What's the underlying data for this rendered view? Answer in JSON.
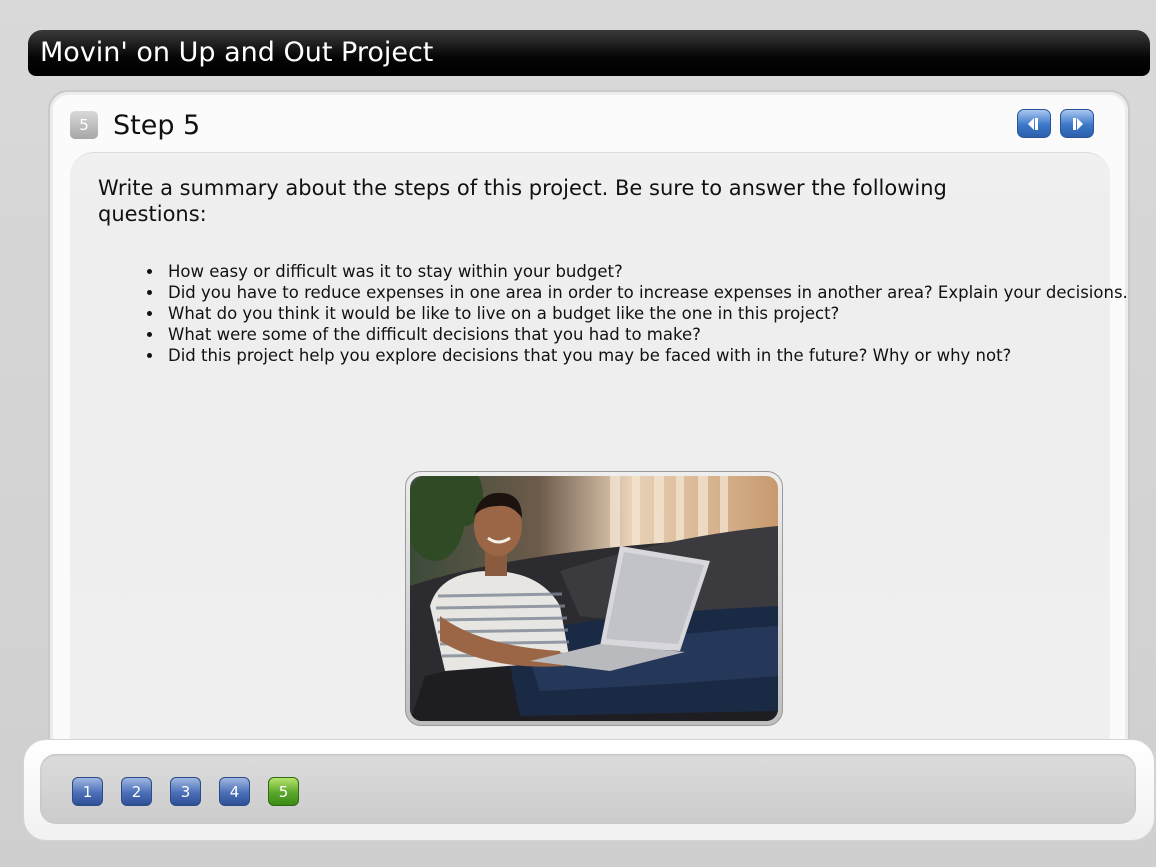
{
  "window": {
    "title": "Movin' on Up and Out Project"
  },
  "step": {
    "badge": "5",
    "title": "Step 5"
  },
  "nav": {
    "prev_icon": "previous-arrow-icon",
    "next_icon": "next-arrow-icon"
  },
  "content": {
    "intro": "Write a summary about the steps of this project.  Be sure to answer the following questions:",
    "questions": [
      "How easy or difficult was it to stay within your budget?",
      "Did you have to reduce expenses in one area in order to increase expenses in another area?  Explain your decisions.",
      "What do you think it would be like to live on a budget like the one in this project?",
      "What were some of the difficult decisions that you had to make?",
      "Did this project help you explore decisions that you may be faced with in the future?  Why or why not?"
    ]
  },
  "pages": {
    "items": [
      "1",
      "2",
      "3",
      "4",
      "5"
    ],
    "active": "5"
  },
  "colors": {
    "accent_blue": "#3d78c9",
    "active_green": "#5aa72a",
    "title_bar": "#000000"
  }
}
